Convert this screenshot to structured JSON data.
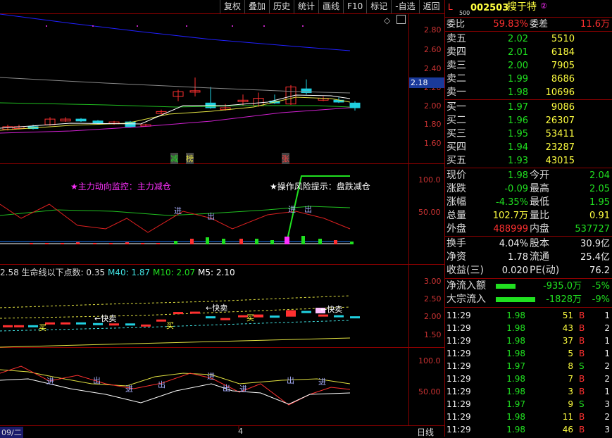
{
  "menu": [
    "复权",
    "叠加",
    "历史",
    "统计",
    "画线",
    "F10",
    "标记",
    "-自选",
    "返回"
  ],
  "stock": {
    "flag_l": "L",
    "flag_num": "500",
    "code": "002503",
    "name": "搜于特",
    "badge": "②"
  },
  "weibi": {
    "label1": "委比",
    "val1": "59.83%",
    "label2": "委差",
    "val2": "11.6万"
  },
  "asks": [
    {
      "label": "卖五",
      "price": "2.02",
      "vol": "5510"
    },
    {
      "label": "卖四",
      "price": "2.01",
      "vol": "6184"
    },
    {
      "label": "卖三",
      "price": "2.00",
      "vol": "7905"
    },
    {
      "label": "卖二",
      "price": "1.99",
      "vol": "8686"
    },
    {
      "label": "卖一",
      "price": "1.98",
      "vol": "10696"
    }
  ],
  "bids": [
    {
      "label": "买一",
      "price": "1.97",
      "vol": "9086"
    },
    {
      "label": "买二",
      "price": "1.96",
      "vol": "26307"
    },
    {
      "label": "买三",
      "price": "1.95",
      "vol": "53411"
    },
    {
      "label": "买四",
      "price": "1.94",
      "vol": "23287"
    },
    {
      "label": "买五",
      "price": "1.93",
      "vol": "43015"
    }
  ],
  "quote": [
    {
      "l1": "现价",
      "v1": "1.98",
      "l2": "今开",
      "v2": "2.04"
    },
    {
      "l1": "涨跌",
      "v1": "-0.09",
      "l2": "最高",
      "v2": "2.05"
    },
    {
      "l1": "涨幅",
      "v1": "-4.35%",
      "l2": "最低",
      "v2": "1.95"
    },
    {
      "l1": "总量",
      "v1": "102.7万",
      "l2": "量比",
      "v2": "0.91"
    },
    {
      "l1": "外盘",
      "v1": "488999",
      "l2": "内盘",
      "v2": "537727"
    }
  ],
  "stats": [
    {
      "l1": "换手",
      "v1": "4.04%",
      "l2": "股本",
      "v2": "30.9亿"
    },
    {
      "l1": "净资",
      "v1": "1.78",
      "l2": "流通",
      "v2": "25.4亿"
    },
    {
      "l1": "收益(三)",
      "v1": "0.020",
      "l2": "PE(动)",
      "v2": "76.2"
    }
  ],
  "flows": [
    {
      "label": "净流入额",
      "value": "-935.0万",
      "pct": "-5%"
    },
    {
      "label": "大宗流入",
      "value": "-1828万",
      "pct": "-9%"
    }
  ],
  "trades": [
    {
      "time": "11:29",
      "price": "1.98",
      "vol": "51",
      "bs": "B",
      "n": "1"
    },
    {
      "time": "11:29",
      "price": "1.98",
      "vol": "43",
      "bs": "B",
      "n": "2"
    },
    {
      "time": "11:29",
      "price": "1.98",
      "vol": "37",
      "bs": "B",
      "n": "1"
    },
    {
      "time": "11:29",
      "price": "1.98",
      "vol": "5",
      "bs": "B",
      "n": "1"
    },
    {
      "time": "11:29",
      "price": "1.97",
      "vol": "8",
      "bs": "S",
      "n": "2"
    },
    {
      "time": "11:29",
      "price": "1.98",
      "vol": "7",
      "bs": "B",
      "n": "2"
    },
    {
      "time": "11:29",
      "price": "1.98",
      "vol": "3",
      "bs": "B",
      "n": "1"
    },
    {
      "time": "11:29",
      "price": "1.97",
      "vol": "9",
      "bs": "S",
      "n": "3"
    },
    {
      "time": "11:29",
      "price": "1.98",
      "vol": "11",
      "bs": "B",
      "n": "2"
    },
    {
      "time": "11:29",
      "price": "1.98",
      "vol": "46",
      "bs": "B",
      "n": "3"
    }
  ],
  "main_axis": [
    "2.80",
    "2.60",
    "2.40",
    "2.20",
    "2.00",
    "1.80",
    "1.60"
  ],
  "current_price_tag": "2.18",
  "markers": {
    "jian": "减",
    "bang": "榜",
    "zhang": "张"
  },
  "ind1": {
    "axis": [
      "100.0",
      "50.00"
    ],
    "note_left": "★主力动向监控：主力减仓",
    "note_right": "★操作风险提示：盘跌减仓",
    "jin": "进",
    "chu": "出"
  },
  "ind2": {
    "axis": [
      "3.00",
      "2.50",
      "2.00",
      "1.50"
    ],
    "legend": {
      "prefix": "2.58",
      "l1": "生命线以下点数: 0.35",
      "l2": "M40: 1.87",
      "l3": "M10: 2.07",
      "l4": "M5: 2.10"
    },
    "sell1": "←快卖",
    "sell2": "←快卖",
    "sell3": "←快卖",
    "buy1": "买",
    "buy2": "买",
    "buy3": "买"
  },
  "ind3": {
    "axis": [
      "100.0",
      "50.00"
    ]
  },
  "bottom": {
    "date": "09/二",
    "mid": "4",
    "period": "日线"
  },
  "colors": {
    "up": "#ff3030",
    "down": "#20d0e0",
    "grid": "#8b0000",
    "ma_green": "#20c020",
    "ma_magenta": "#d020d0",
    "ma_yellow": "#e0e040",
    "ma_blue": "#2020ff"
  }
}
